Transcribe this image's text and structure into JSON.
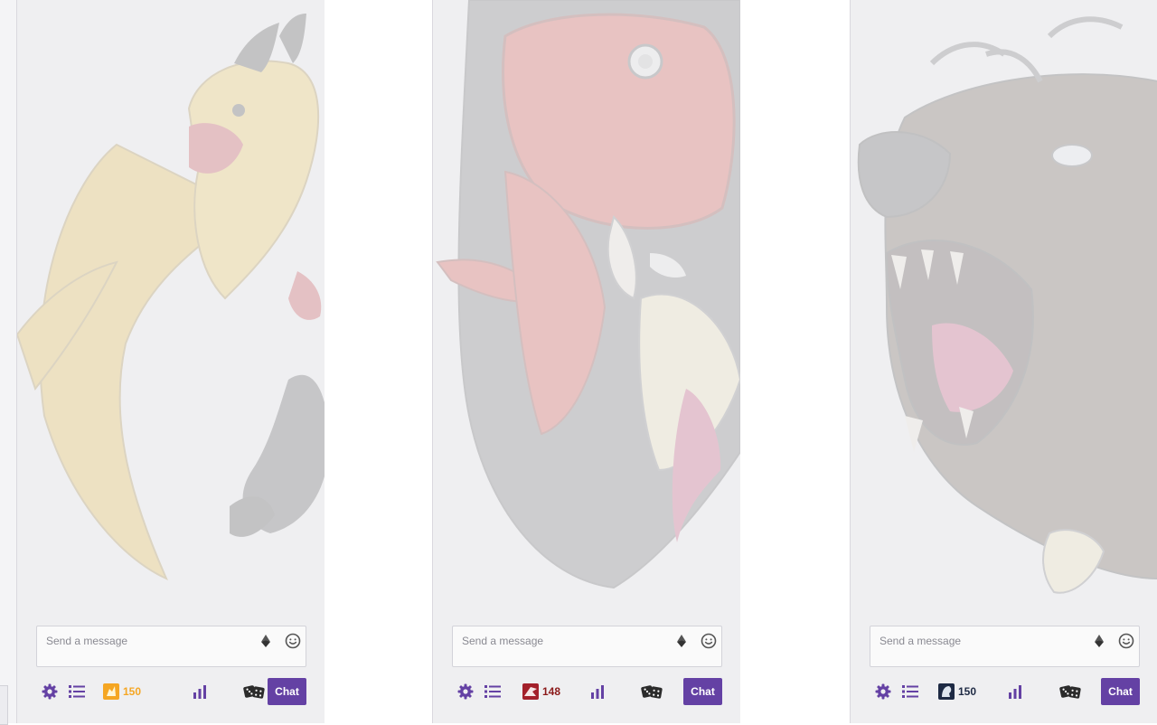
{
  "colors": {
    "accent": "#6441a4",
    "panel_background": "#efeff1",
    "icon_purple": "#6441a4"
  },
  "panels": [
    {
      "name": "griffin",
      "art_icon": "griffin-illustration",
      "input": {
        "placeholder": "Send a message",
        "value": ""
      },
      "points": {
        "value": "150",
        "color": "#f5a623",
        "badge_icon": "griffin-badge-icon",
        "badge_color": "#f5a623"
      },
      "chat_button_label": "Chat"
    },
    {
      "name": "dragon",
      "art_icon": "dragon-illustration",
      "input": {
        "placeholder": "Send a message",
        "value": ""
      },
      "points": {
        "value": "148",
        "color": "#8b1a1a",
        "badge_icon": "dragon-badge-icon",
        "badge_color": "#a3202a"
      },
      "chat_button_label": "Chat"
    },
    {
      "name": "bear",
      "art_icon": "bear-illustration",
      "input": {
        "placeholder": "Send a message",
        "value": ""
      },
      "points": {
        "value": "150",
        "color": "#1e2a44",
        "badge_icon": "bear-badge-icon",
        "badge_color": "#1e2a44"
      },
      "chat_button_label": "Chat"
    }
  ],
  "icons": {
    "settings": "gear-icon",
    "viewer_list": "list-icon",
    "stats": "bar-chart-icon",
    "dice": "dice-icon",
    "bits": "bits-icon",
    "emotes": "smiley-icon"
  }
}
